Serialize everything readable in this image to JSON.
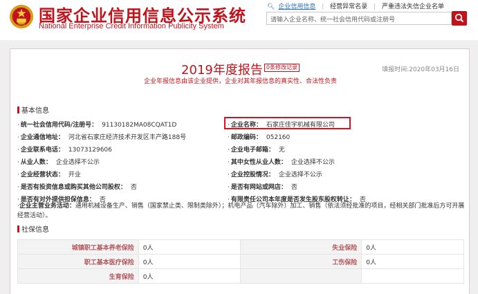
{
  "header": {
    "title": "国家企业信用信息公示系统",
    "subtitle": "National Enterprise Credit Information Publicity System",
    "emblem_icon": "national-emblem-icon",
    "nav": [
      {
        "label": "企业信用信息",
        "active": true
      },
      {
        "label": "经营异常名录",
        "active": false
      },
      {
        "label": "严重违法失信企业名单",
        "active": false
      }
    ],
    "search_placeholder": "请输入企业名称、统一社会信用代码或注册号",
    "search_icon": "search-icon",
    "brand_color": "#c0131c"
  },
  "report": {
    "title": "2019年度报告",
    "revision_badge": "0条修改记录",
    "fill_date": "填报时间:2020年03月16日",
    "note": "企业年报信息由该企业提供，企业对其年报信息的真实性、合法性负责"
  },
  "basic": {
    "heading": "基本信息",
    "left": [
      {
        "label": "统一社会信用代码/注册号：",
        "value": "91130182MA08CQAT1D"
      },
      {
        "label": "企业通信地址：",
        "value": "河北省石家庄经济技术开发区丰产路188号"
      },
      {
        "label": "企业联系电话：",
        "value": "13073129606"
      },
      {
        "label": "从业人数：",
        "value": "企业选择不公示"
      },
      {
        "label": "企业经营状态：",
        "value": "开业"
      },
      {
        "label": "是否有投资信息或购买其他公司股权：",
        "value": "否"
      },
      {
        "label": "是否有对外提供担保信息：",
        "value": "否"
      }
    ],
    "right": [
      {
        "label": "企业名称：",
        "value": "石家庄佳宇机械有限公司"
      },
      {
        "label": "邮政编码：",
        "value": "052160"
      },
      {
        "label": "企业电子邮箱：",
        "value": "无"
      },
      {
        "label": "其中女性从业人数：",
        "value": "企业选择不公示"
      },
      {
        "label": "企业控股情况：",
        "value": "企业选择不公示"
      },
      {
        "label": "是否有网站或网店：",
        "value": "否"
      },
      {
        "label": "有限责任公司本年度是否发生股东股权转让：",
        "value": "否"
      }
    ],
    "business_scope_label": "企业主营业务活动：",
    "business_scope_value": "通用机械设备生产、销售（国家禁止类、限制类除外）；机电产品（汽车除外）加工、销售（依法须经批准的项目，经相关部门批准后方可开展经营活动）。"
  },
  "social": {
    "heading": "社保信息",
    "rows": [
      [
        {
          "label": "城镇职工基本养老保险",
          "value": "0人"
        },
        {
          "label": "失业保险",
          "value": "0人"
        }
      ],
      [
        {
          "label": "职工基本医疗保险",
          "value": "0人"
        },
        {
          "label": "工伤保险",
          "value": "0人"
        }
      ],
      [
        {
          "label": "生育保险",
          "value": "0人"
        },
        {
          "label": "",
          "value": ""
        }
      ]
    ]
  }
}
